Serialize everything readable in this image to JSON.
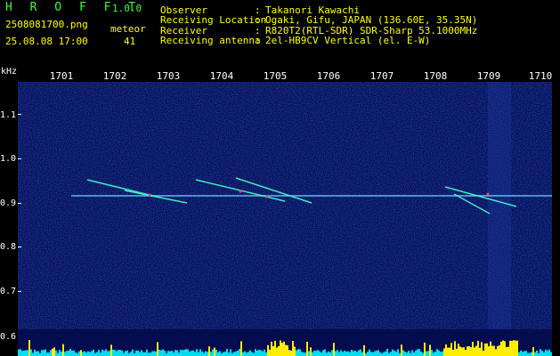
{
  "header": {
    "app_name": "H R O F F T",
    "version": "1.0.0",
    "filename": "2508081700.png",
    "datetime": "25.08.08 17:00",
    "meteor_label": "meteor",
    "meteor_count": "41"
  },
  "info": [
    {
      "key": "Observer",
      "value": "Takanori Kawachi"
    },
    {
      "key": "Receiving Location",
      "value": "Ogaki, Gifu, JAPAN (136.60E, 35.35N)"
    },
    {
      "key": "Receiver",
      "value": "R820T2(RTL-SDR) SDR-Sharp 53.1000MHz"
    },
    {
      "key": "Receiving antenna",
      "value": "2el-HB9CV Vertical (el. E-W)"
    }
  ],
  "info_colon": ":",
  "axis": {
    "unit": "kHz",
    "y_ticks": [
      "1.1",
      "1.0",
      "0.9",
      "0.8",
      "0.7",
      "0.6"
    ],
    "x_ticks": [
      "1701",
      "1702",
      "1703",
      "1704",
      "1705",
      "1706",
      "1707",
      "1708",
      "1709",
      "1710"
    ]
  },
  "colors": {
    "text_primary": "#33ff33",
    "text_secondary": "#ffff00",
    "text_tertiary": "#ffffff",
    "background": "#000000",
    "spectrogram_bg": "#020a4a",
    "carrier": "#66ccff",
    "meteor_trace": "#44ffcc",
    "histogram_cyan": "#00ddee",
    "histogram_yellow": "#ffee00"
  }
}
